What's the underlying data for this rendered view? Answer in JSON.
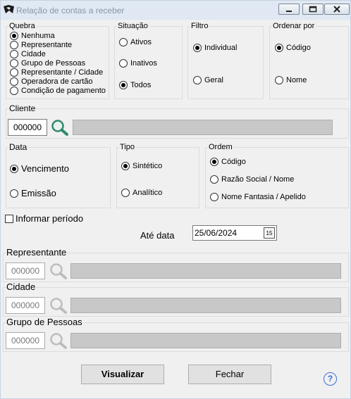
{
  "window": {
    "title": "Relação de contas a receber"
  },
  "quebra": {
    "legend": "Quebra",
    "options": [
      "Nenhuma",
      "Representante",
      "Cidade",
      "Grupo de Pessoas",
      "Representante / Cidade",
      "Operadora de cartão",
      "Condição de pagamento"
    ],
    "selected": "Nenhuma"
  },
  "situacao": {
    "legend": "Situação",
    "options": [
      "Ativos",
      "Inativos",
      "Todos"
    ],
    "selected": "Todos"
  },
  "filtro": {
    "legend": "Filtro",
    "options": [
      "Individual",
      "Geral"
    ],
    "selected": "Individual"
  },
  "ordenar": {
    "legend": "Ordenar por",
    "options": [
      "Código",
      "Nome"
    ],
    "selected": "Código"
  },
  "cliente": {
    "legend": "Cliente",
    "code": "000000",
    "name": ""
  },
  "data": {
    "legend": "Data",
    "options": [
      "Vencimento",
      "Emissão"
    ],
    "selected": "Vencimento"
  },
  "tipo": {
    "legend": "Tipo",
    "options": [
      "Sintético",
      "Analítico"
    ],
    "selected": "Sintético"
  },
  "ordem": {
    "legend": "Ordem",
    "options": [
      "Código",
      "Razão Social / Nome",
      "Nome Fantasia / Apelido"
    ],
    "selected": "Código"
  },
  "periodo": {
    "checkbox_label": "Informar período",
    "checked": false,
    "ate_label": "Até data",
    "ate_value": "25/06/2024",
    "calendar_label": "15"
  },
  "representante": {
    "legend": "Representante",
    "code": "000000",
    "name": ""
  },
  "cidade": {
    "legend": "Cidade",
    "code": "000000",
    "name": ""
  },
  "grupo": {
    "legend": "Grupo de Pessoas",
    "code": "000000",
    "name": ""
  },
  "buttons": {
    "visualizar": "Visualizar",
    "fechar": "Fechar",
    "help": "?"
  },
  "colors": {
    "titlebar": "#dfe8f3",
    "disabled_bar": "#c8c8c8",
    "help_accent": "#3a6ed8"
  }
}
